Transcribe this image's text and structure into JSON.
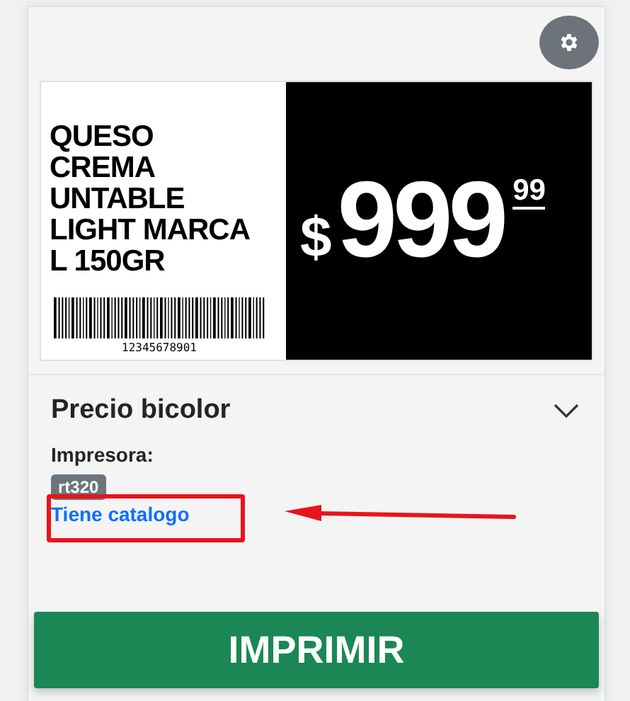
{
  "label": {
    "product_name": "QUESO CREMA UNTABLE LIGHT MARCA L 150GR",
    "barcode_number": "12345678901",
    "currency": "$",
    "price_integer": "999",
    "price_cents": "99"
  },
  "section": {
    "title": "Precio bicolor",
    "expanded": true,
    "printer_label": "Impresora:",
    "printer": "rt320",
    "link": "Tiene catalogo"
  },
  "print_button": "IMPRIMIR"
}
